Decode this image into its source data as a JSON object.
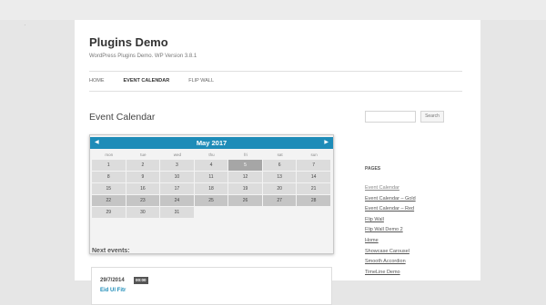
{
  "site": {
    "title": "Plugins Demo",
    "description": "WordPress Plugins Demo. WP Version 3.8.1"
  },
  "nav": {
    "items": [
      {
        "label": "HOME",
        "active": false
      },
      {
        "label": "EVENT CALENDAR",
        "active": true
      },
      {
        "label": "FLIP WALL",
        "active": false
      }
    ]
  },
  "page": {
    "title": "Event Calendar"
  },
  "calendar": {
    "month_label": "May 2017",
    "prev_icon": "left-triangle-icon",
    "next_icon": "right-triangle-icon",
    "weekdays": [
      "mon",
      "tue",
      "wed",
      "thu",
      "fri",
      "sat",
      "sun"
    ],
    "weeks": [
      [
        "1",
        "2",
        "3",
        "4",
        "5",
        "6",
        "7"
      ],
      [
        "8",
        "9",
        "10",
        "11",
        "12",
        "13",
        "14"
      ],
      [
        "15",
        "16",
        "17",
        "18",
        "19",
        "20",
        "21"
      ],
      [
        "22",
        "23",
        "24",
        "25",
        "26",
        "27",
        "28"
      ],
      [
        "29",
        "30",
        "31",
        "",
        "",
        "",
        ""
      ]
    ],
    "highlighted_day": "5",
    "colors": {
      "header": "#1e8cb8",
      "highlight": "#a6a6a6"
    }
  },
  "events": {
    "heading": "Next events:",
    "items": [
      {
        "date": "29/7/2014",
        "time": "00:00",
        "title": "Eid Ul Fitr"
      }
    ]
  },
  "sidebar": {
    "search_button": "Search",
    "search_placeholder": "",
    "pages_title": "PAGES",
    "pages": [
      "Event Calendar",
      "Event Calendar – Gold",
      "Event Calendar – Red",
      "Flip Wall",
      "Flip Wall Demo 2",
      "Home",
      "Showcase Carousel",
      "Smooth Accordion",
      "TimeLine Demo"
    ]
  }
}
